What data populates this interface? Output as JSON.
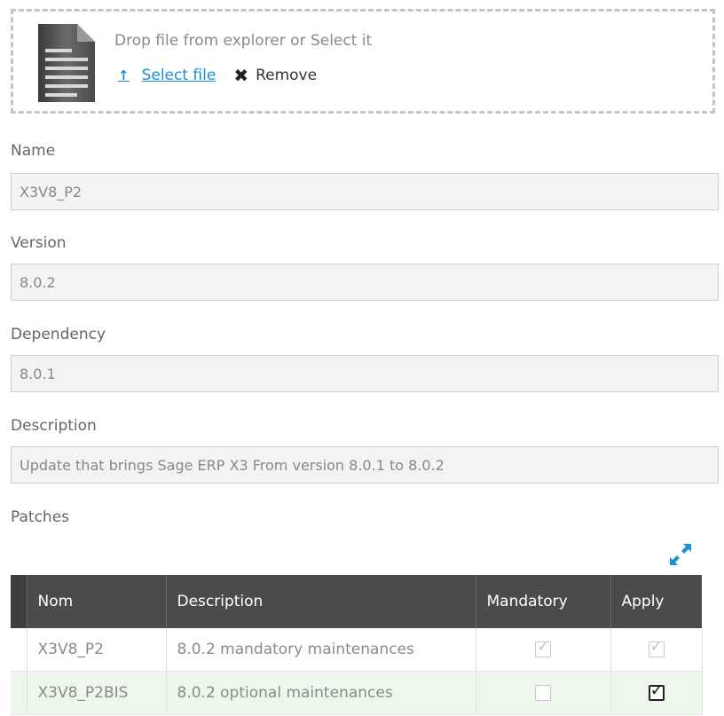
{
  "upload": {
    "drop_text": "Drop file from explorer or Select it",
    "select_label": "Select file",
    "remove_label": "Remove"
  },
  "fields": {
    "name": {
      "label": "Name",
      "value": "X3V8_P2"
    },
    "version": {
      "label": "Version",
      "value": "8.0.2"
    },
    "dependency": {
      "label": "Dependency",
      "value": "8.0.1"
    },
    "description": {
      "label": "Description",
      "value": "Update that brings Sage ERP X3 From version 8.0.1 to 8.0.2"
    }
  },
  "patches": {
    "label": "Patches",
    "columns": [
      "Nom",
      "Description",
      "Mandatory",
      "Apply"
    ],
    "rows": [
      {
        "nom": "X3V8_P2",
        "description": "8.0.2 mandatory maintenances",
        "mandatory": true,
        "apply": true,
        "disabled": true
      },
      {
        "nom": "X3V8_P2BIS",
        "description": "8.0.2 optional maintenances",
        "mandatory": false,
        "apply": true,
        "disabled": false
      }
    ]
  },
  "colors": {
    "link": "#1d8fd6",
    "table_header": "#4a4b4c",
    "row_highlight": "#eef7ec"
  }
}
